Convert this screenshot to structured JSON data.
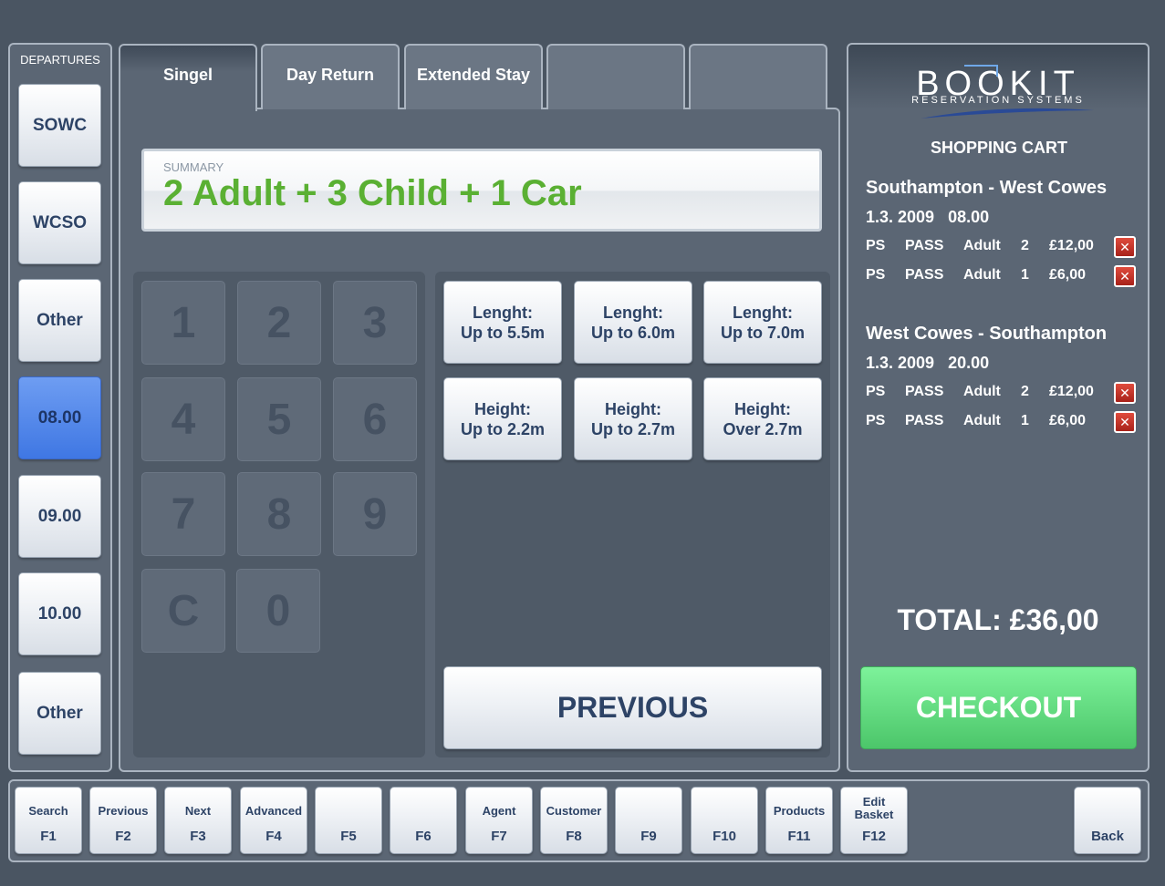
{
  "departures": {
    "title": "DEPARTURES",
    "items": [
      {
        "label": "SOWC",
        "active": false
      },
      {
        "label": "WCSO",
        "active": false
      },
      {
        "label": "Other",
        "active": false
      },
      {
        "label": "08.00",
        "active": true
      },
      {
        "label": "09.00",
        "active": false
      },
      {
        "label": "10.00",
        "active": false
      },
      {
        "label": "Other",
        "active": false
      }
    ]
  },
  "tabs": [
    {
      "label": "Singel",
      "active": true
    },
    {
      "label": "Day Return",
      "active": false
    },
    {
      "label": "Extended Stay",
      "active": false
    },
    {
      "label": "",
      "active": false
    },
    {
      "label": "",
      "active": false
    }
  ],
  "summary": {
    "label": "SUMMARY",
    "value": "2 Adult + 3 Child + 1 Car"
  },
  "keypad": [
    "1",
    "2",
    "3",
    "4",
    "5",
    "6",
    "7",
    "8",
    "9",
    "C",
    "0"
  ],
  "options": [
    {
      "line1": "Lenght:",
      "line2": "Up to 5.5m"
    },
    {
      "line1": "Lenght:",
      "line2": "Up to 6.0m"
    },
    {
      "line1": "Lenght:",
      "line2": "Up to 7.0m"
    },
    {
      "line1": "Height:",
      "line2": "Up to 2.2m"
    },
    {
      "line1": "Height:",
      "line2": "Up to 2.7m"
    },
    {
      "line1": "Height:",
      "line2": "Over 2.7m"
    }
  ],
  "previous_label": "PREVIOUS",
  "cart": {
    "logo_main": "BOOKIT",
    "logo_sub": "RESERVATION SYSTEMS",
    "title": "SHOPPING CART",
    "trips": [
      {
        "route": "Southampton - West Cowes",
        "date": "1.3. 2009",
        "time": "08.00",
        "lines": [
          {
            "code": "PS",
            "type": "PASS",
            "category": "Adult",
            "qty": "2",
            "price": "£12,00"
          },
          {
            "code": "PS",
            "type": "PASS",
            "category": "Adult",
            "qty": "1",
            "price": "£6,00"
          }
        ]
      },
      {
        "route": "West Cowes - Southampton",
        "date": "1.3. 2009",
        "time": "20.00",
        "lines": [
          {
            "code": "PS",
            "type": "PASS",
            "category": "Adult",
            "qty": "2",
            "price": "£12,00"
          },
          {
            "code": "PS",
            "type": "PASS",
            "category": "Adult",
            "qty": "1",
            "price": "£6,00"
          }
        ]
      }
    ],
    "delete_glyph": "✕",
    "total": "TOTAL: £36,00",
    "checkout_label": "CHECKOUT"
  },
  "function_keys": [
    {
      "label": "Search",
      "key": "F1"
    },
    {
      "label": "Previous",
      "key": "F2"
    },
    {
      "label": "Next",
      "key": "F3"
    },
    {
      "label": "Advanced",
      "key": "F4"
    },
    {
      "label": "",
      "key": "F5"
    },
    {
      "label": "",
      "key": "F6"
    },
    {
      "label": "Agent",
      "key": "F7"
    },
    {
      "label": "Customer",
      "key": "F8"
    },
    {
      "label": "",
      "key": "F9"
    },
    {
      "label": "",
      "key": "F10"
    },
    {
      "label": "Products",
      "key": "F11"
    },
    {
      "label": "Edit Basket",
      "key": "F12"
    }
  ],
  "back_label": "Back",
  "colors": {
    "background": "#4a5562",
    "panel": "#5b6674",
    "accent_blue": "#4a82ea",
    "summary_green": "#5ab033",
    "checkout_green": "#5ed67c",
    "delete_red": "#c0301f",
    "button_text": "#2d4366"
  }
}
